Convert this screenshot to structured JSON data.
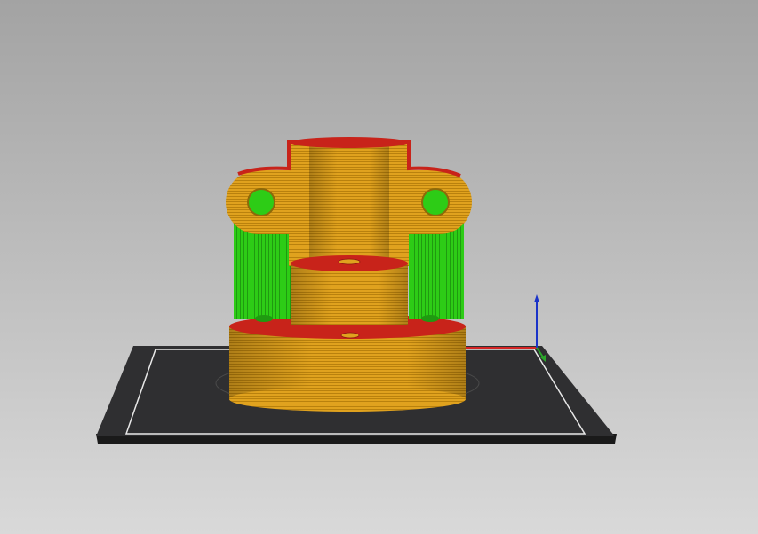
{
  "viewport": {
    "background_top": "#a3a3a3",
    "background_bottom": "#d9d9d9"
  },
  "bed": {
    "surface_color": "#2f2f31",
    "edge_color": "#1a1a1a",
    "outline_color": "#e8e8e8"
  },
  "model": {
    "perimeter_color": "#e0a21e",
    "perimeter_stripe_color": "#b9810d",
    "top_surface_color": "#c8231a",
    "support_color": "#2dcc16",
    "support_stripe_color": "#1f9a10"
  },
  "axes": {
    "z_color": "#1a33c8",
    "x_color": "#d42424",
    "y_color": "#2aa52a"
  }
}
